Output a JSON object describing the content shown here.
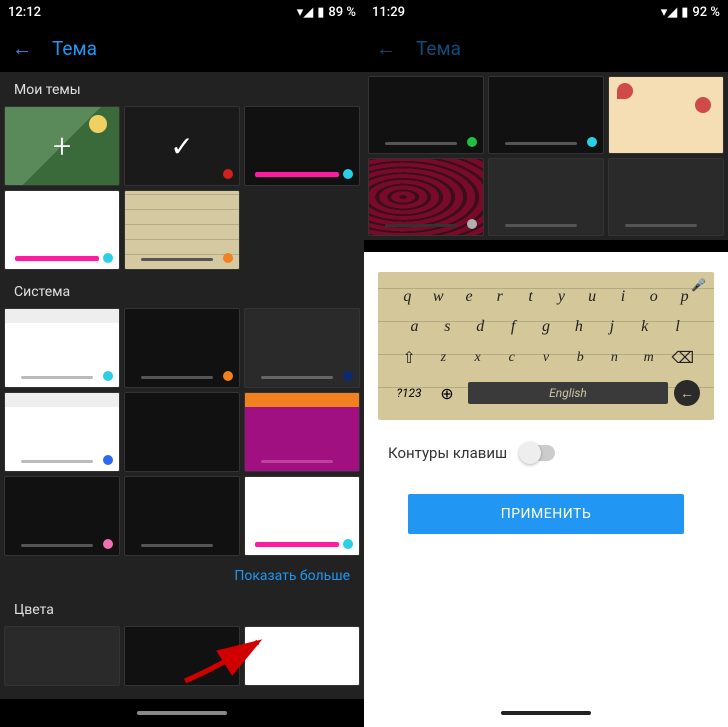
{
  "left": {
    "status": {
      "time": "12:12",
      "battery": "89 %"
    },
    "appbar": {
      "title": "Тема"
    },
    "sections": {
      "my_themes": "Мои темы",
      "system": "Система",
      "colors": "Цвета"
    },
    "show_more": "Показать больше",
    "tiles": {
      "t3_dot": "#2ad0e6",
      "t3_bar": "#ff1aa0",
      "t4_dot": "#2ad0e6",
      "t4_bar": "#ff1aa0",
      "t5_dot": "#f08020",
      "s1_dot": "#2ad0e6",
      "s2_dot": "#f08020",
      "s3_dot": "#0a2a70",
      "s4_dot": "#2a6af0",
      "s6_dot": "#f070b0",
      "s8_bar": "#ff1aa0",
      "s8_dot": "#2ad0e6",
      "magenta": "#a01080",
      "orange_strip": "#f08020"
    }
  },
  "right": {
    "status": {
      "time": "11:29",
      "battery": "92 %"
    },
    "appbar": {
      "title": "Тема"
    },
    "toggle_label": "Контуры клавиш",
    "apply": "ПРИМЕНИТЬ",
    "kb": {
      "row1": [
        "q",
        "w",
        "e",
        "r",
        "t",
        "y",
        "u",
        "i",
        "o",
        "p"
      ],
      "row2": [
        "a",
        "s",
        "d",
        "f",
        "g",
        "h",
        "j",
        "k",
        "l"
      ],
      "row3": [
        "z",
        "x",
        "c",
        "v",
        "b",
        "n",
        "m"
      ],
      "sym": "?123",
      "space": "English"
    },
    "tiles": {
      "g_dot": "#20c040",
      "b_dot": "#2ad0e6",
      "gray_dot": "#b0b0b0"
    }
  }
}
